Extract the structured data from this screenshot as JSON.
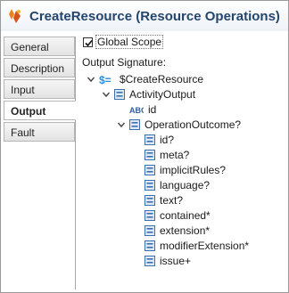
{
  "window": {
    "title": "CreateResource (Resource Operations)"
  },
  "sidebar": {
    "tabs": [
      {
        "label": "General"
      },
      {
        "label": "Description"
      },
      {
        "label": "Input"
      },
      {
        "label": "Output",
        "active": true
      },
      {
        "label": "Fault"
      }
    ]
  },
  "output": {
    "global_scope_label": "Global Scope",
    "global_scope_checked": true,
    "signature_label": "Output Signature:",
    "tree": [
      {
        "label": "$CreateResource",
        "icon": "variable-icon",
        "expanded": true
      },
      {
        "label": "ActivityOutput",
        "icon": "element-icon",
        "expanded": true
      },
      {
        "label": "id",
        "icon": "string-type-icon"
      },
      {
        "label": "OperationOutcome?",
        "icon": "element-icon",
        "expanded": true
      },
      {
        "label": "id?",
        "icon": "element-icon"
      },
      {
        "label": "meta?",
        "icon": "element-icon"
      },
      {
        "label": "implicitRules?",
        "icon": "element-icon"
      },
      {
        "label": "language?",
        "icon": "element-icon"
      },
      {
        "label": "text?",
        "icon": "element-icon"
      },
      {
        "label": "contained*",
        "icon": "element-icon"
      },
      {
        "label": "extension*",
        "icon": "element-icon"
      },
      {
        "label": "modifierExtension*",
        "icon": "element-icon"
      },
      {
        "label": "issue+",
        "icon": "element-icon"
      }
    ]
  },
  "colors": {
    "title_text": "#23466e",
    "element_icon": "#3b6fae",
    "variable_icon": "#2f8bd6"
  }
}
